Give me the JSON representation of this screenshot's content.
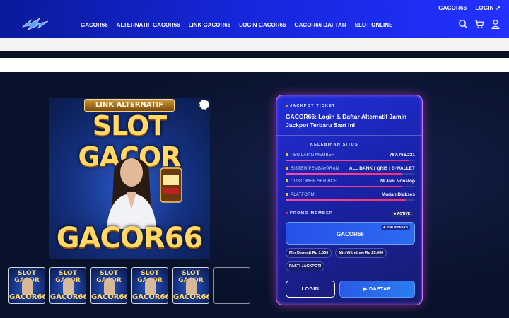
{
  "header": {
    "topbar": [
      "GACOR66",
      "LOGIN ↗"
    ],
    "nav": [
      "GACOR66",
      "ALTERNATIF GACOR66",
      "LINK GACOR66",
      "LOGIN GACOR66",
      "GACOR66 DAFTAR",
      "SLOT ONLINE"
    ],
    "icons": [
      "search-icon",
      "cart-icon",
      "user-icon"
    ]
  },
  "banner": {
    "ribbon": "LINK ALTERNATIF",
    "title_top": "SLOT GACOR",
    "title_bottom": "GACOR66"
  },
  "thumbs": {
    "top": "SLOT GACOR",
    "bottom": "GACOR66"
  },
  "card": {
    "label": "JACKPOT TICKET",
    "title": "GACOR66: Login & Daftar Alternatif Jamin Jackpot Terbaru Saat Ini",
    "section_label": "KELEBIHAN SITUS",
    "rows": [
      {
        "key": "PENILAIAN MEMBER",
        "value": "767.766.231",
        "fill": 0.95
      },
      {
        "key": "SISTEM PEMBAYARAN",
        "value": "ALL BANK | QRIS | E-WALLET",
        "fill": 0.9
      },
      {
        "key": "CUSTOMER SERVICE",
        "value": "24 Jam Nonstop",
        "fill": 0.9
      },
      {
        "key": "PLATFORM",
        "value": "Mudah Diakses",
        "fill": 0.93
      }
    ],
    "promo_label": "PROMO MEMBER",
    "promo_badge": "ACTIVE",
    "promo_name": "GACOR66",
    "promo_top": "TOP REWARD",
    "chips": [
      "Min Deposit Rp 1.000",
      "Min Withdraw Rp 25.000",
      "PASTI JACKPOT!"
    ],
    "login": "LOGIN",
    "daftar": "▶ DAFTAR"
  },
  "colors": {
    "header": "#1526d8",
    "accent": "#ff3a8a",
    "glow": "#c87aff"
  }
}
